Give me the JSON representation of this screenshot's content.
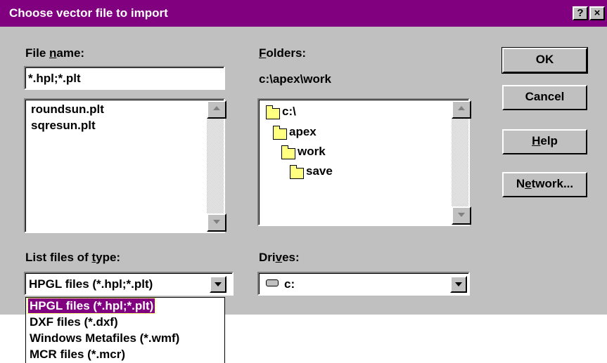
{
  "window": {
    "title": "Choose vector file to import",
    "help_button": "?",
    "close_button": "×"
  },
  "file_name": {
    "label_pre": "File ",
    "label_ul": "n",
    "label_post": "ame:",
    "value": "*.hpl;*.plt",
    "files": [
      "roundsun.plt",
      "sqresun.plt"
    ]
  },
  "folders": {
    "label_ul": "F",
    "label_post": "olders:",
    "current_path": "c:\\apex\\work",
    "tree": [
      {
        "name": "c:\\",
        "state": "open"
      },
      {
        "name": "apex",
        "state": "open"
      },
      {
        "name": "work",
        "state": "open"
      },
      {
        "name": "save",
        "state": "closed"
      }
    ]
  },
  "buttons": {
    "ok": "OK",
    "cancel": "Cancel",
    "help_ul": "H",
    "help_post": "elp",
    "network_pre": "N",
    "network_ul": "e",
    "network_post": "twork..."
  },
  "file_type": {
    "label_pre": "List files of ",
    "label_ul": "t",
    "label_post": "ype:",
    "selected": "HPGL files (*.hpl;*.plt)",
    "options": [
      "HPGL files (*.hpl;*.plt)",
      "DXF files (*.dxf)",
      "Windows Metafiles (*.wmf)",
      "MCR files (*.mcr)"
    ],
    "highlighted_index": 0
  },
  "drives": {
    "label_pre": "Dri",
    "label_ul": "v",
    "label_post": "es:",
    "selected": "c:"
  },
  "colors": {
    "title_bar": "#800080",
    "dialog_face": "#c0c0c0",
    "selection": "#800080"
  }
}
